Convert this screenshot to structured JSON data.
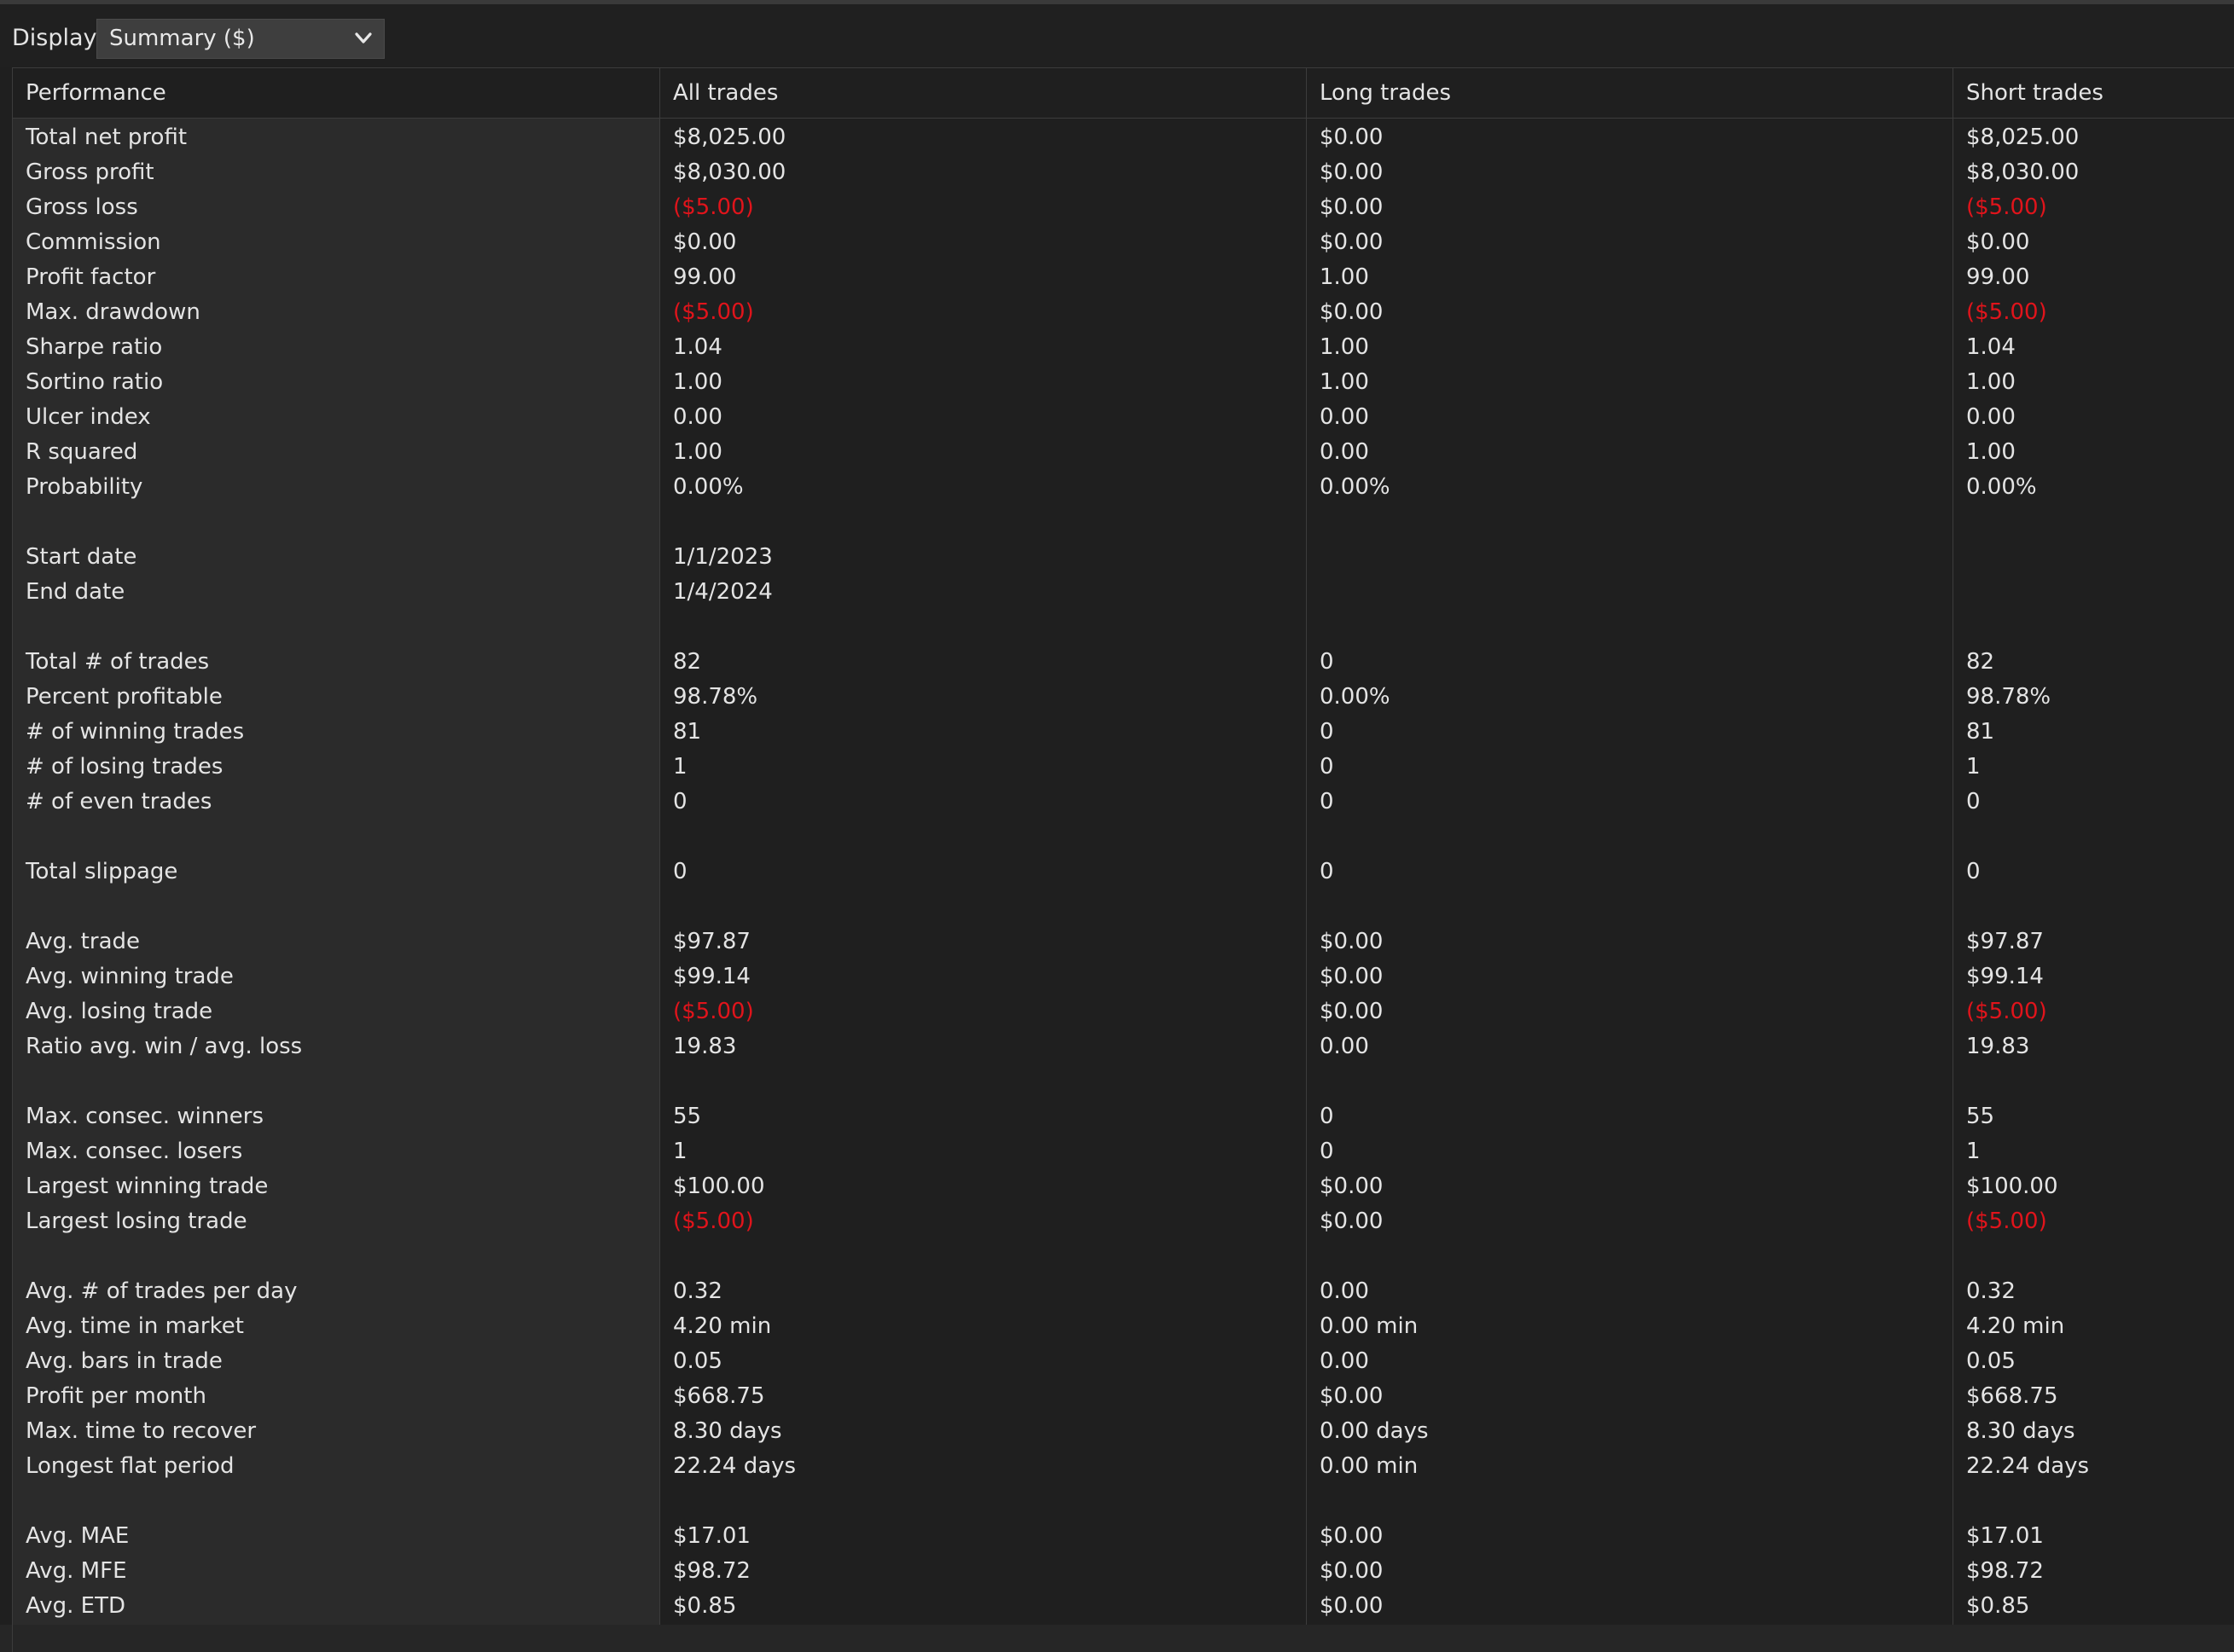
{
  "display": {
    "label": "Display",
    "selected": "Summary ($)"
  },
  "colors": {
    "negative": "#e0141b",
    "text": "#e4e4e4",
    "background": "#1f1f1f",
    "label_column": "#2b2b2b"
  },
  "table": {
    "headers": [
      "Performance",
      "All trades",
      "Long trades",
      "Short trades"
    ],
    "rows": [
      {
        "label": "Total net profit",
        "all": "$8,025.00",
        "long": "$0.00",
        "short": "$8,025.00"
      },
      {
        "label": "Gross profit",
        "all": "$8,030.00",
        "long": "$0.00",
        "short": "$8,030.00"
      },
      {
        "label": "Gross loss",
        "all": "($5.00)",
        "long": "$0.00",
        "short": "($5.00)"
      },
      {
        "label": "Commission",
        "all": "$0.00",
        "long": "$0.00",
        "short": "$0.00"
      },
      {
        "label": "Profit factor",
        "all": "99.00",
        "long": "1.00",
        "short": "99.00"
      },
      {
        "label": "Max. drawdown",
        "all": "($5.00)",
        "long": "$0.00",
        "short": "($5.00)"
      },
      {
        "label": "Sharpe ratio",
        "all": "1.04",
        "long": "1.00",
        "short": "1.04"
      },
      {
        "label": "Sortino ratio",
        "all": "1.00",
        "long": "1.00",
        "short": "1.00"
      },
      {
        "label": "Ulcer index",
        "all": "0.00",
        "long": "0.00",
        "short": "0.00"
      },
      {
        "label": "R squared",
        "all": "1.00",
        "long": "0.00",
        "short": "1.00"
      },
      {
        "label": "Probability",
        "all": "0.00%",
        "long": "0.00%",
        "short": "0.00%"
      },
      {
        "label": "",
        "all": "",
        "long": "",
        "short": ""
      },
      {
        "label": "Start date",
        "all": "1/1/2023",
        "long": "",
        "short": ""
      },
      {
        "label": "End date",
        "all": "1/4/2024",
        "long": "",
        "short": ""
      },
      {
        "label": "",
        "all": "",
        "long": "",
        "short": ""
      },
      {
        "label": "Total # of trades",
        "all": "82",
        "long": "0",
        "short": "82"
      },
      {
        "label": "Percent profitable",
        "all": "98.78%",
        "long": "0.00%",
        "short": "98.78%"
      },
      {
        "label": "# of winning trades",
        "all": "81",
        "long": "0",
        "short": "81"
      },
      {
        "label": "# of losing trades",
        "all": "1",
        "long": "0",
        "short": "1"
      },
      {
        "label": "# of even trades",
        "all": "0",
        "long": "0",
        "short": "0"
      },
      {
        "label": "",
        "all": "",
        "long": "",
        "short": ""
      },
      {
        "label": "Total slippage",
        "all": "0",
        "long": "0",
        "short": "0"
      },
      {
        "label": "",
        "all": "",
        "long": "",
        "short": ""
      },
      {
        "label": "Avg. trade",
        "all": "$97.87",
        "long": "$0.00",
        "short": "$97.87"
      },
      {
        "label": "Avg. winning trade",
        "all": "$99.14",
        "long": "$0.00",
        "short": "$99.14"
      },
      {
        "label": "Avg. losing trade",
        "all": "($5.00)",
        "long": "$0.00",
        "short": "($5.00)"
      },
      {
        "label": "Ratio avg. win / avg. loss",
        "all": "19.83",
        "long": "0.00",
        "short": "19.83"
      },
      {
        "label": "",
        "all": "",
        "long": "",
        "short": ""
      },
      {
        "label": "Max. consec. winners",
        "all": "55",
        "long": "0",
        "short": "55"
      },
      {
        "label": "Max. consec. losers",
        "all": "1",
        "long": "0",
        "short": "1"
      },
      {
        "label": "Largest winning trade",
        "all": "$100.00",
        "long": "$0.00",
        "short": "$100.00"
      },
      {
        "label": "Largest losing trade",
        "all": "($5.00)",
        "long": "$0.00",
        "short": "($5.00)"
      },
      {
        "label": "",
        "all": "",
        "long": "",
        "short": ""
      },
      {
        "label": "Avg. # of trades per day",
        "all": "0.32",
        "long": "0.00",
        "short": "0.32"
      },
      {
        "label": "Avg. time in market",
        "all": "4.20 min",
        "long": "0.00 min",
        "short": "4.20 min"
      },
      {
        "label": "Avg. bars in trade",
        "all": "0.05",
        "long": "0.00",
        "short": "0.05"
      },
      {
        "label": "Profit per month",
        "all": "$668.75",
        "long": "$0.00",
        "short": "$668.75"
      },
      {
        "label": "Max. time to recover",
        "all": "8.30 days",
        "long": "0.00 days",
        "short": "8.30 days"
      },
      {
        "label": "Longest flat period",
        "all": "22.24 days",
        "long": "0.00 min",
        "short": "22.24 days"
      },
      {
        "label": "",
        "all": "",
        "long": "",
        "short": ""
      },
      {
        "label": "Avg. MAE",
        "all": "$17.01",
        "long": "$0.00",
        "short": "$17.01"
      },
      {
        "label": "Avg. MFE",
        "all": "$98.72",
        "long": "$0.00",
        "short": "$98.72"
      },
      {
        "label": "Avg. ETD",
        "all": "$0.85",
        "long": "$0.00",
        "short": "$0.85"
      }
    ]
  }
}
